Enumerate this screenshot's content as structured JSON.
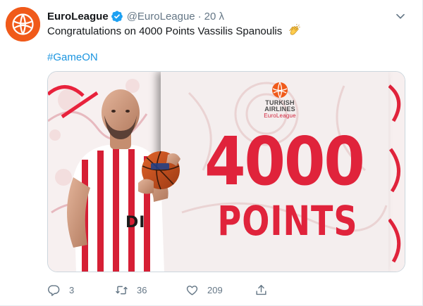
{
  "tweet": {
    "display_name": "EuroLeague",
    "handle": "@EuroLeague",
    "separator": "·",
    "time": "20 λ",
    "text": "Congratulations on 4000 Points Vassilis Spanoulis",
    "hashtag": "#GameON"
  },
  "media": {
    "sponsor_line1": "TURKISH",
    "sponsor_line2": "AIRLINES",
    "sponsor_line3": "EuroLeague",
    "headline_number": "4000",
    "headline_label": "POINTS",
    "jersey_text": "DI"
  },
  "actions": {
    "replies": "3",
    "retweets": "36",
    "likes": "209"
  },
  "icons": [
    "euroleague-logo-icon",
    "verified-icon",
    "chevron-down-icon",
    "clapping-hands-icon",
    "reply-icon",
    "retweet-icon",
    "like-icon",
    "share-icon"
  ],
  "colors": {
    "brand_orange": "#f05a1a",
    "link_blue": "#1b95e0",
    "muted": "#657786",
    "olympiacos_red": "#e0233b"
  }
}
